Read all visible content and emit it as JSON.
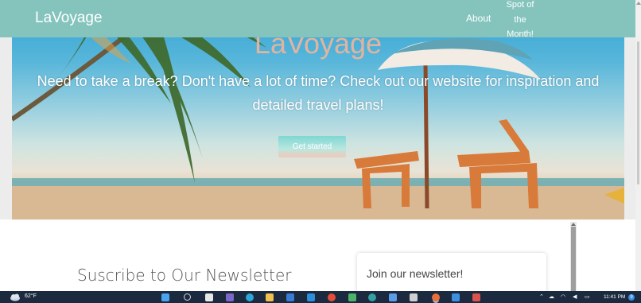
{
  "navbar": {
    "brand": "LaVoyage",
    "links": [
      {
        "label": "About"
      },
      {
        "label": "Spot of the Month!",
        "lines": [
          "Spot of",
          "the",
          "Month!"
        ]
      }
    ]
  },
  "hero": {
    "title": "LaVoyage",
    "subtitle": "Need to take a break? Don't have a lot of time? Check out our website for inspiration and detailed travel plans!",
    "cta_label": "Get started"
  },
  "newsletter": {
    "heading": "Suscribe to Our Newsletter",
    "card_title": "Join our newsletter!"
  },
  "taskbar": {
    "temperature": "62°F",
    "time": "11:41 PM",
    "notification_count": "9",
    "icons": [
      "start-icon",
      "search-icon",
      "task-view-icon",
      "chat-icon",
      "edge-icon",
      "file-explorer-icon",
      "store-icon",
      "mail-icon",
      "chrome-icon",
      "app-icon",
      "app-icon",
      "app-icon",
      "chrome-active-icon",
      "app-icon",
      "app-icon"
    ]
  },
  "colors": {
    "navbar": "#85c4bd",
    "hero_title": "#f1b59a",
    "taskbar": "#1b2a3f"
  }
}
